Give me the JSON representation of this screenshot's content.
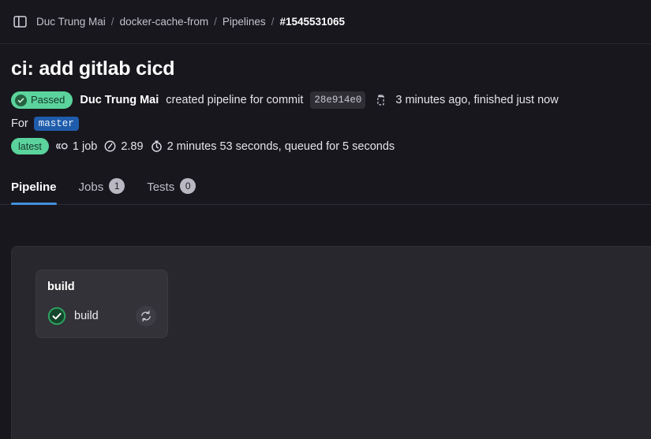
{
  "breadcrumb": {
    "toggle_icon": "sidebar-toggle-icon",
    "items": [
      {
        "label": "Duc Trung Mai"
      },
      {
        "label": "docker-cache-from"
      },
      {
        "label": "Pipelines"
      }
    ],
    "separator": "/",
    "current": "#1545531065"
  },
  "header": {
    "title": "ci: add gitlab cicd",
    "status_badge": {
      "label": "Passed",
      "icon": "check-icon",
      "bg": "#5bd39c",
      "fg": "#14372a"
    },
    "author": "Duc Trung Mai",
    "action_text": "created pipeline for commit",
    "commit_sha": "28e914e0",
    "copy_icon": "copy-to-clipboard-icon",
    "time_text": "3 minutes ago, finished just now",
    "for_label": "For",
    "branch": "master",
    "latest_badge": "latest",
    "jobs_icon": "pipeline-jobs-icon",
    "jobs_count_text": "1 job",
    "gauge_icon": "gauge-icon",
    "gauge_value": "2.89",
    "duration_icon": "stopwatch-icon",
    "duration_text": "2 minutes 53 seconds, queued for 5 seconds"
  },
  "tabs": [
    {
      "label": "Pipeline",
      "badge": null,
      "active": true
    },
    {
      "label": "Jobs",
      "badge": "1",
      "active": false
    },
    {
      "label": "Tests",
      "badge": "0",
      "active": false
    }
  ],
  "graph": {
    "stage_name": "build",
    "job": {
      "name": "build",
      "status_icon": "status-success-icon",
      "retry_icon": "retry-icon"
    }
  },
  "colors": {
    "accent_blue": "#428fdc",
    "success_green": "#5bd39c",
    "page_bg": "#18171d",
    "panel_bg": "#28272d",
    "card_bg": "#333238"
  }
}
